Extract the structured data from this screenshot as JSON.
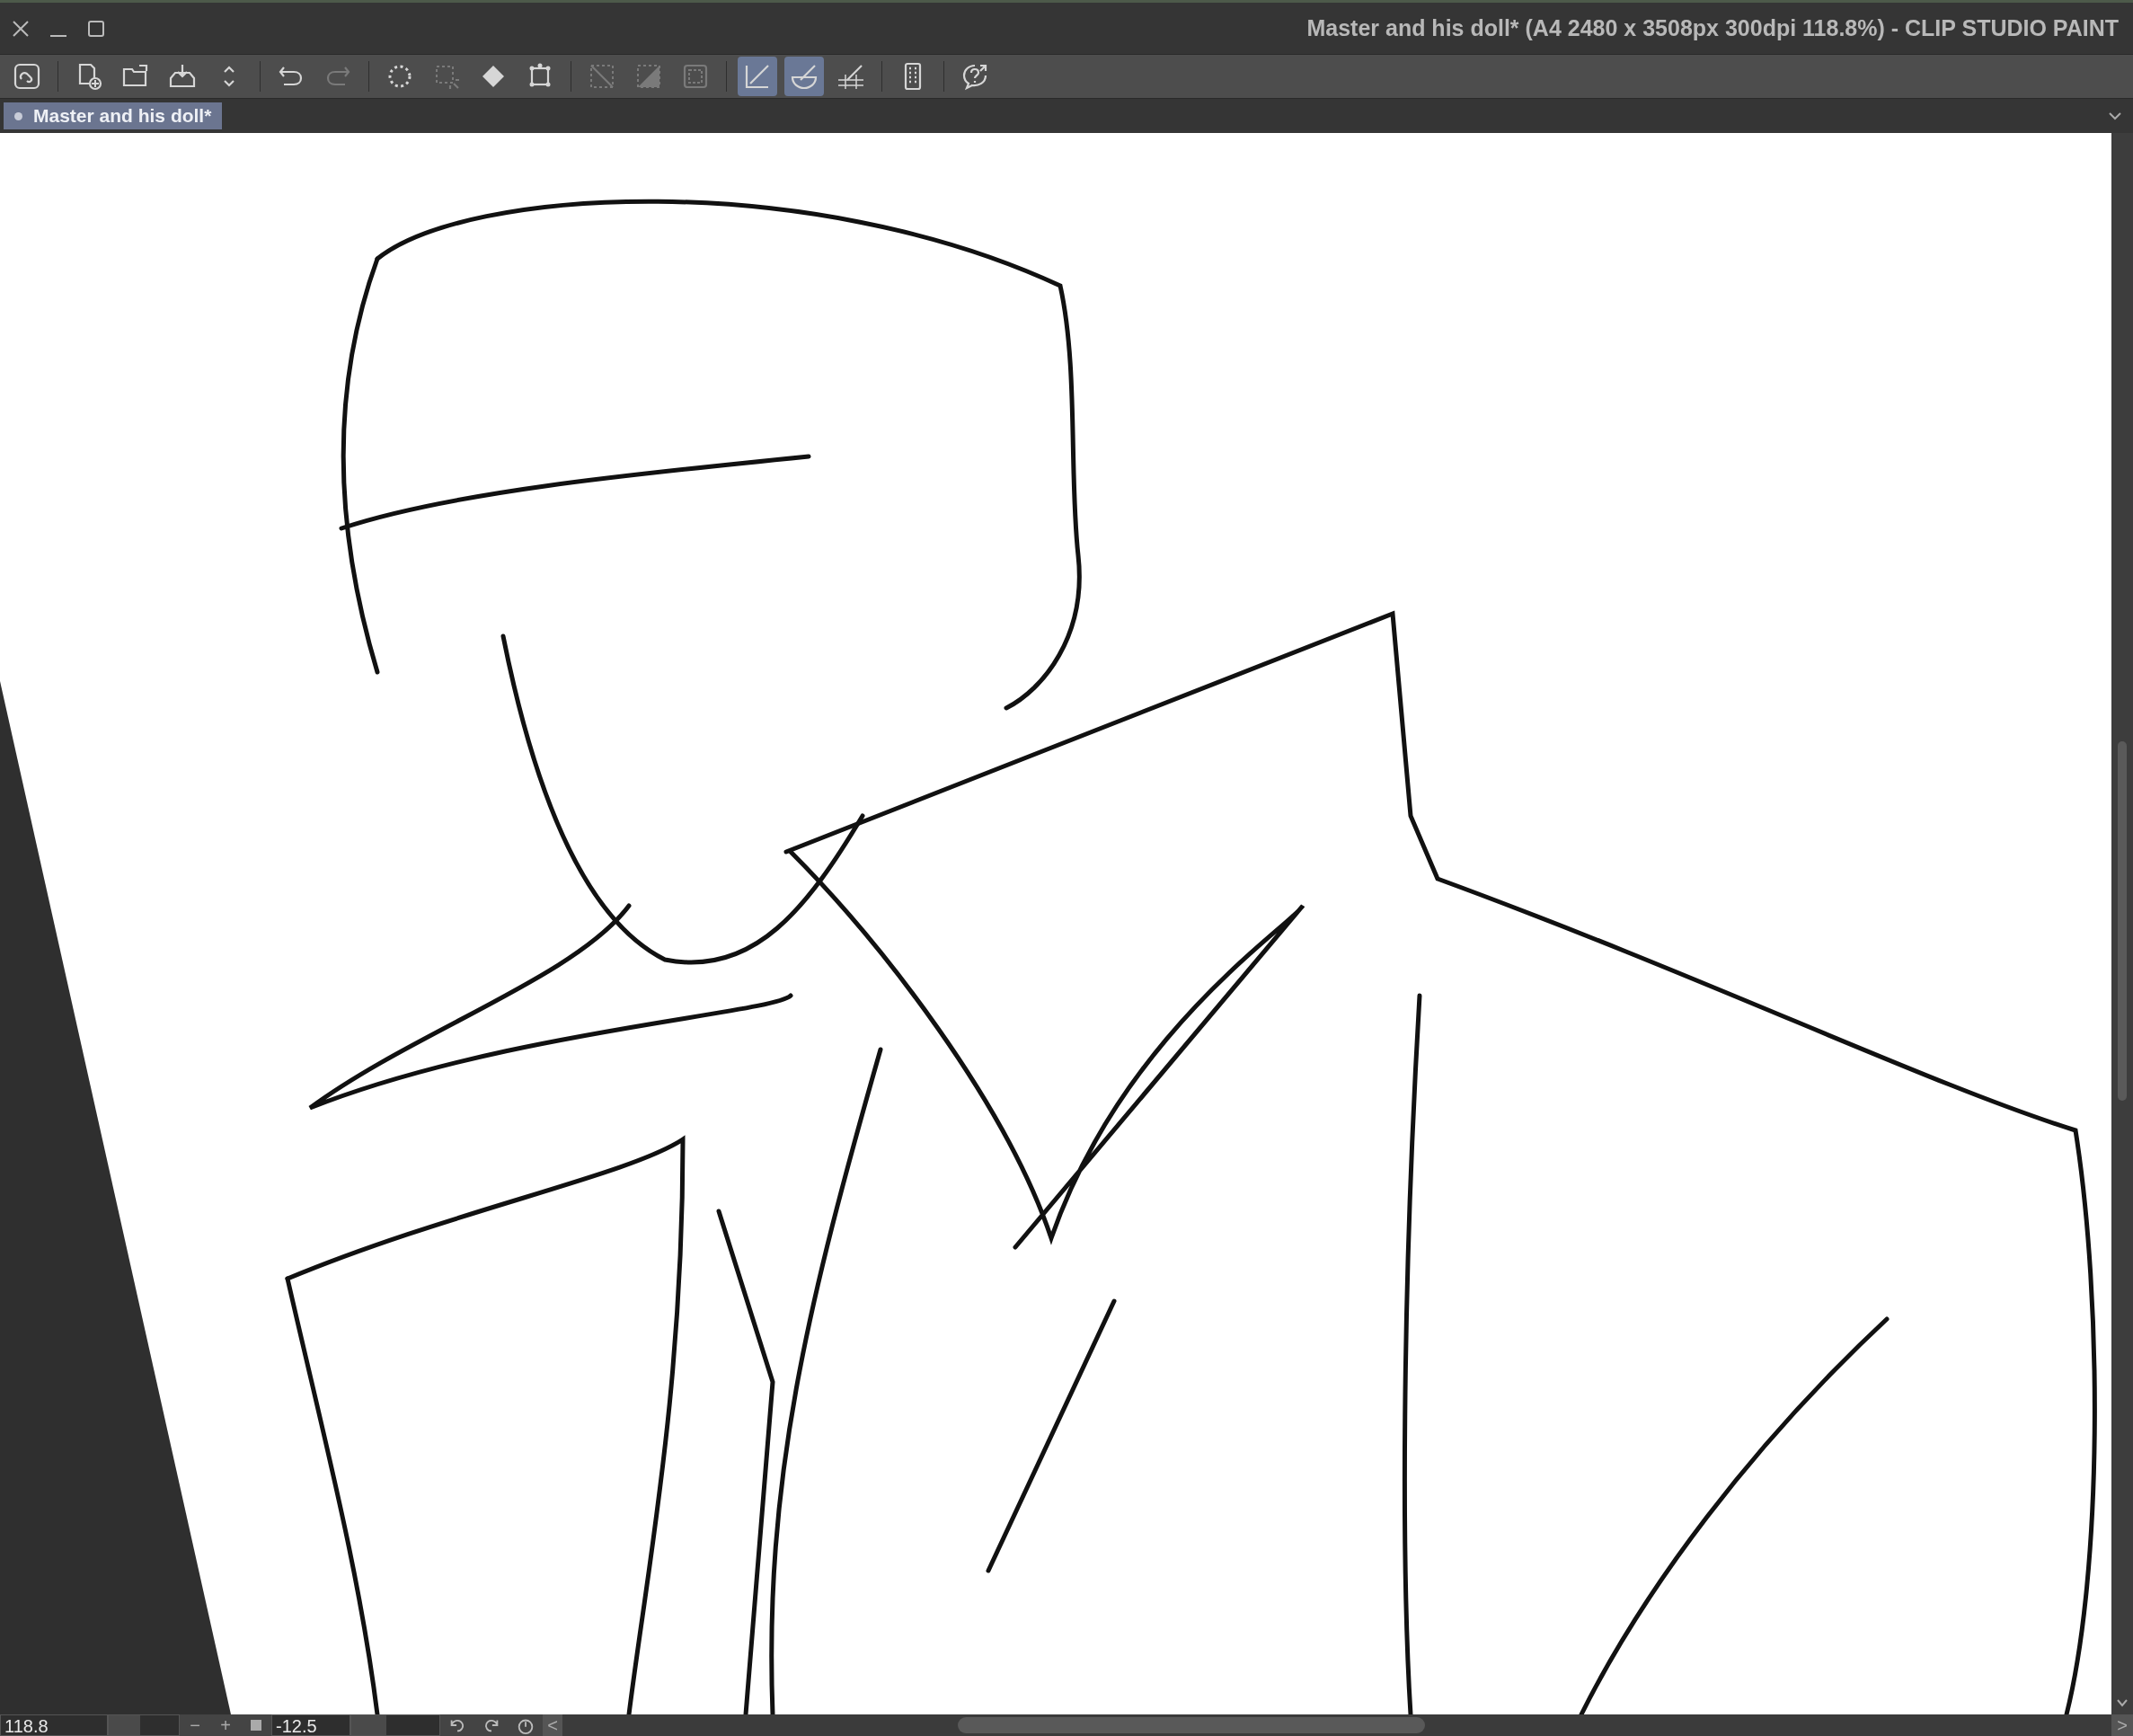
{
  "window": {
    "title": "Master and his doll* (A4 2480 x 3508px 300dpi 118.8%)  - CLIP STUDIO PAINT"
  },
  "toolbar": [
    {
      "kind": "app",
      "active": false,
      "disabled": false
    },
    {
      "kind": "sep"
    },
    {
      "kind": "new",
      "active": false,
      "disabled": false
    },
    {
      "kind": "open",
      "active": false,
      "disabled": false
    },
    {
      "kind": "save",
      "active": false,
      "disabled": false
    },
    {
      "kind": "updown",
      "active": false,
      "disabled": false
    },
    {
      "kind": "sep"
    },
    {
      "kind": "undo",
      "active": false,
      "disabled": false
    },
    {
      "kind": "redo",
      "active": false,
      "disabled": true
    },
    {
      "kind": "sep"
    },
    {
      "kind": "select-all",
      "active": false,
      "disabled": false
    },
    {
      "kind": "deselect",
      "active": false,
      "disabled": true
    },
    {
      "kind": "fill",
      "active": false,
      "disabled": false
    },
    {
      "kind": "transform",
      "active": false,
      "disabled": false
    },
    {
      "kind": "sep"
    },
    {
      "kind": "clear",
      "active": false,
      "disabled": true
    },
    {
      "kind": "clear-outside",
      "active": false,
      "disabled": true
    },
    {
      "kind": "crop",
      "active": false,
      "disabled": true
    },
    {
      "kind": "sep"
    },
    {
      "kind": "ruler",
      "active": true,
      "disabled": false
    },
    {
      "kind": "curve-ruler",
      "active": true,
      "disabled": false
    },
    {
      "kind": "ruler-grid",
      "active": false,
      "disabled": false
    },
    {
      "kind": "sep"
    },
    {
      "kind": "device",
      "active": false,
      "disabled": false
    },
    {
      "kind": "sep"
    },
    {
      "kind": "help",
      "active": false,
      "disabled": false
    }
  ],
  "tabs": [
    {
      "label": "Master and his doll*",
      "selected": true
    }
  ],
  "status_bar": {
    "zoom": "118.8",
    "zoom_minus": "−",
    "zoom_plus": "+",
    "zoom_slider": {
      "level": 0.45
    },
    "rotation": "-12.5",
    "rotation_slider": {
      "level": 0.4
    },
    "scroll_left": "<",
    "scroll_right": ">"
  }
}
